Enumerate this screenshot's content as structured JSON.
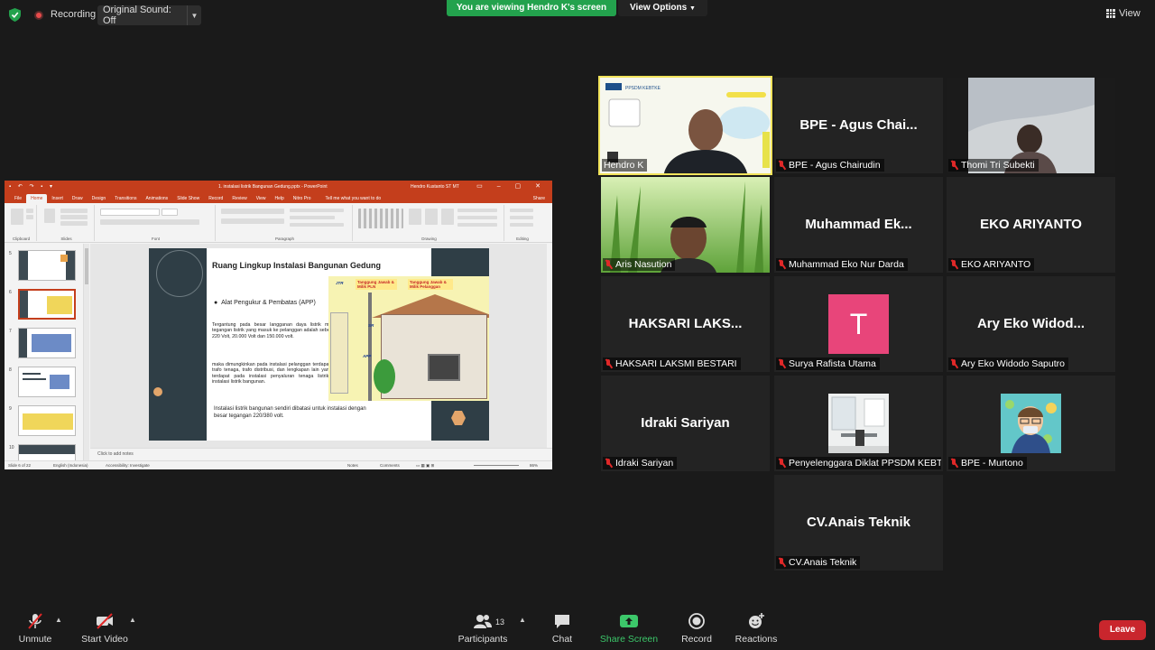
{
  "topbar": {
    "recording_label": "Recording",
    "original_sound": "Original Sound: Off",
    "viewing_banner": "You are viewing Hendro K's screen",
    "view_options": "View Options",
    "view_label": "View"
  },
  "ppt": {
    "filename": "1. instalasi listrik Bangunan Gedung.pptx - PowerPoint",
    "user": "Hendro Kustanto ST MT",
    "tabs": [
      "File",
      "Home",
      "Insert",
      "Draw",
      "Design",
      "Transitions",
      "Animations",
      "Slide Show",
      "Record",
      "Review",
      "View",
      "Help",
      "Nitro Pro"
    ],
    "active_tab": "Home",
    "tell_me": "Tell me what you want to do",
    "share": "Share",
    "groups": [
      "Clipboard",
      "Slides",
      "Font",
      "Paragraph",
      "Drawing",
      "Editing"
    ],
    "slide_numbers": [
      "5",
      "6",
      "7",
      "8",
      "9",
      "10"
    ],
    "slide": {
      "title": "Ruang Lingkup Instalasi Bangunan Gedung",
      "bullet": "Alat Pengukur & Pembatas (APP)",
      "para1": "Tergantung pada besar langganan daya listrik maka tegangan listrik yang masuk ke pelanggan adalah sebesar 220 Volt, 20.000 Volt dan 150.000 volt.",
      "para2": "maka dimungkinkan pada instalasi pelanggan terdapat gardu, trafo tenaga, trafo distribusi, dan lengkapan lain yang biasa terdapat pada instalasi penyaluran tenaga listrik selain instalasi listrik bangunan.",
      "conclusion": "Instalasi listrik bangunan sendiri dibatasi untuk instalasi dengan besar tegangan 220/380 volt.",
      "diagram_labels": {
        "jtr": "JTR",
        "resp1": "Tanggung Jawab & Milik PLN",
        "resp2": "Tanggung Jawab & Milik Pelanggan",
        "sr": "SR",
        "app": "APP"
      }
    },
    "notes_placeholder": "Click to add notes",
    "status": {
      "slide_of": "Slide 6 of 22",
      "language": "English (Indonesia)",
      "accessibility": "Accessibility: Investigate",
      "notes": "Notes",
      "comments": "Comments",
      "zoom": "86%"
    }
  },
  "participants": [
    {
      "big": "",
      "name": "Hendro K",
      "muted": false,
      "type": "video-speaker"
    },
    {
      "big": "BPE - Agus Chai...",
      "name": "BPE - Agus Chairudin",
      "muted": true,
      "type": "name"
    },
    {
      "big": "",
      "name": "Thomi Tri Subekti",
      "muted": true,
      "type": "video-room"
    },
    {
      "big": "",
      "name": "Aris Nasution",
      "muted": true,
      "type": "video-grass"
    },
    {
      "big": "Muhammad  Ek...",
      "name": "Muhammad Eko Nur Darda",
      "muted": true,
      "type": "name"
    },
    {
      "big": "EKO ARIYANTO",
      "name": "EKO ARIYANTO",
      "muted": true,
      "type": "name"
    },
    {
      "big": "HAKSARI  LAKS...",
      "name": "HAKSARI LAKSMI BESTARI",
      "muted": true,
      "type": "name"
    },
    {
      "big": "T",
      "name": "Surya Rafista Utama",
      "muted": true,
      "type": "letter"
    },
    {
      "big": "Ary Eko Widod...",
      "name": "Ary Eko Widodo Saputro",
      "muted": true,
      "type": "name"
    },
    {
      "big": "Idraki Sariyan",
      "name": "Idraki Sariyan",
      "muted": true,
      "type": "name"
    },
    {
      "big": "",
      "name": "Penyelenggara Diklat PPSDM KEBT...",
      "muted": true,
      "type": "photo-room"
    },
    {
      "big": "",
      "name": "BPE - Murtono",
      "muted": true,
      "type": "photo-avatar"
    },
    {
      "big": "CV.Anais Teknik",
      "name": "CV.Anais Teknik",
      "muted": true,
      "type": "name"
    }
  ],
  "toolbar": {
    "unmute": "Unmute",
    "start_video": "Start Video",
    "participants": "Participants",
    "participant_count": "13",
    "chat": "Chat",
    "share_screen": "Share Screen",
    "record": "Record",
    "reactions": "Reactions",
    "leave": "Leave"
  },
  "colors": {
    "accent_green": "#23a24d",
    "leave_red": "#c9262d",
    "speaker_border": "#f1e35b",
    "ppt_red": "#c43e1c"
  }
}
